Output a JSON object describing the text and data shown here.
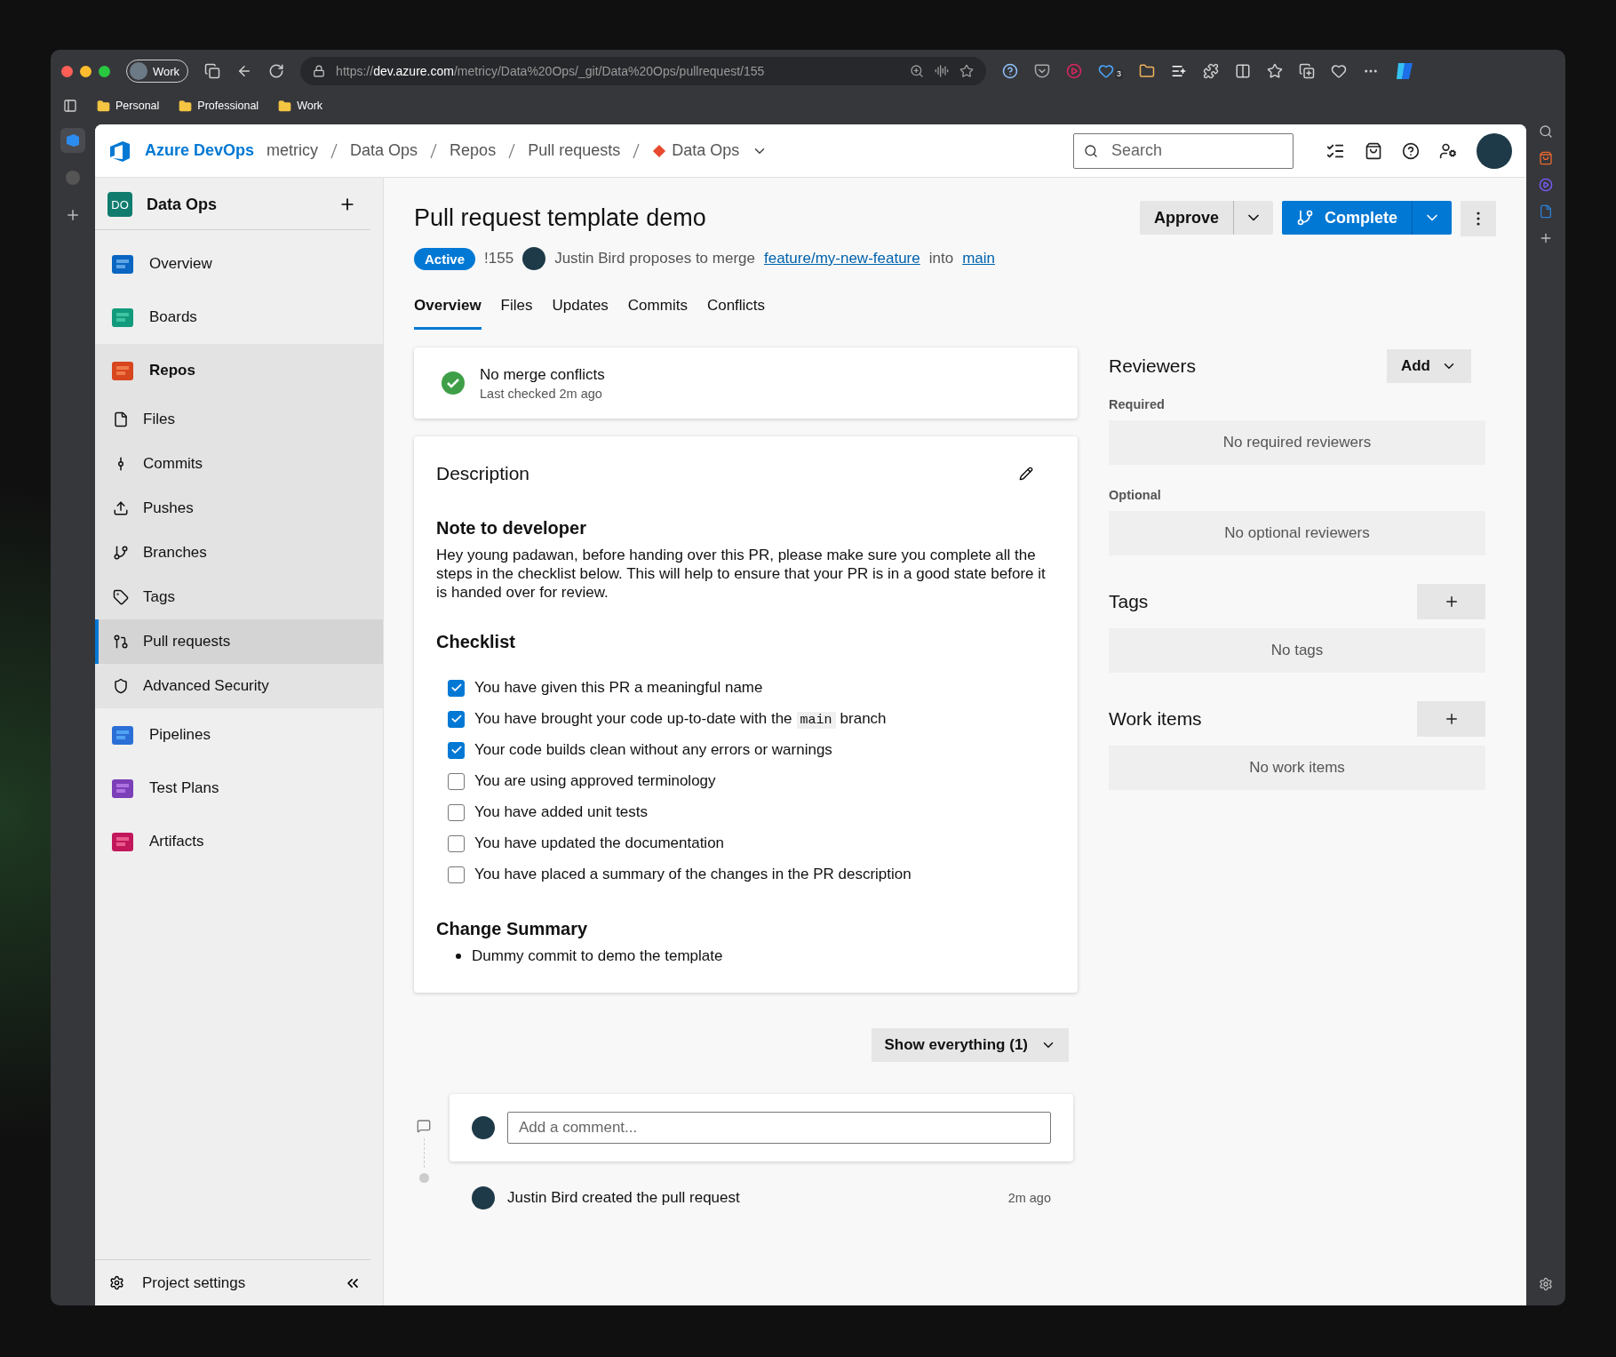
{
  "browser": {
    "profile": "Work",
    "url": {
      "scheme": "https://",
      "host": "dev.azure.com",
      "path": "/metricy/Data%20Ops/_git/Data%20Ops/pullrequest/155"
    },
    "extension_badge": "3",
    "bookmarks": [
      "Personal",
      "Professional",
      "Work"
    ]
  },
  "header": {
    "brand": "Azure DevOps",
    "breadcrumbs": [
      "metricy",
      "Data Ops",
      "Repos",
      "Pull requests",
      "Data Ops"
    ],
    "search": {
      "placeholder": "Search"
    }
  },
  "sidebar": {
    "project": {
      "initials": "DO",
      "name": "Data Ops"
    },
    "items": [
      {
        "label": "Overview",
        "selected": false
      },
      {
        "label": "Boards",
        "selected": false
      },
      {
        "label": "Repos",
        "selected": false,
        "expanded": true,
        "children": [
          {
            "label": "Files",
            "selected": false
          },
          {
            "label": "Commits",
            "selected": false
          },
          {
            "label": "Pushes",
            "selected": false
          },
          {
            "label": "Branches",
            "selected": false
          },
          {
            "label": "Tags",
            "selected": false
          },
          {
            "label": "Pull requests",
            "selected": true
          },
          {
            "label": "Advanced Security",
            "selected": false
          }
        ]
      },
      {
        "label": "Pipelines",
        "selected": false
      },
      {
        "label": "Test Plans",
        "selected": false
      },
      {
        "label": "Artifacts",
        "selected": false
      }
    ],
    "footer": "Project settings"
  },
  "pr": {
    "title": "Pull request template demo",
    "status": "Active",
    "id": "!155",
    "author": "Justin Bird",
    "merge_text": "proposes to merge",
    "source_branch": "feature/my-new-feature",
    "into_text": "into",
    "target_branch": "main",
    "approve": "Approve",
    "complete": "Complete",
    "tabs": [
      {
        "label": "Overview",
        "selected": true
      },
      {
        "label": "Files",
        "selected": false
      },
      {
        "label": "Updates",
        "selected": false
      },
      {
        "label": "Commits",
        "selected": false
      },
      {
        "label": "Conflicts",
        "selected": false
      }
    ]
  },
  "merge_status": {
    "title": "No merge conflicts",
    "subtitle": "Last checked 2m ago"
  },
  "description": {
    "heading": "Description",
    "note_heading": "Note to developer",
    "note": "Hey young padawan, before handing over this PR, please make sure you complete all the steps in the checklist below. This will help to ensure that your PR is in a good state before it is handed over for review.",
    "checklist_heading": "Checklist",
    "checklist": [
      {
        "checked": true,
        "parts": [
          {
            "kind": "text",
            "text": "You have given this PR a meaningful name"
          }
        ]
      },
      {
        "checked": true,
        "parts": [
          {
            "kind": "text",
            "text": "You have brought your code up-to-date with the"
          },
          {
            "kind": "code",
            "text": "main"
          },
          {
            "kind": "text",
            "text": "branch"
          }
        ]
      },
      {
        "checked": true,
        "parts": [
          {
            "kind": "text",
            "text": "Your code builds clean without any errors or warnings"
          }
        ]
      },
      {
        "checked": false,
        "parts": [
          {
            "kind": "text",
            "text": "You are using approved terminology"
          }
        ]
      },
      {
        "checked": false,
        "parts": [
          {
            "kind": "text",
            "text": "You have added unit tests"
          }
        ]
      },
      {
        "checked": false,
        "parts": [
          {
            "kind": "text",
            "text": "You have updated the documentation"
          }
        ]
      },
      {
        "checked": false,
        "parts": [
          {
            "kind": "text",
            "text": "You have placed a summary of the changes in the PR description"
          }
        ]
      }
    ],
    "summary_heading": "Change Summary",
    "summary": [
      "Dummy commit to demo the template"
    ]
  },
  "activity": {
    "filter": "Show everything (1)",
    "comment": {
      "placeholder": "Add a comment..."
    },
    "events": [
      {
        "text": "Justin Bird created the pull request",
        "time": "2m ago"
      }
    ]
  },
  "side": {
    "reviewers": {
      "heading": "Reviewers",
      "add": "Add",
      "groups": [
        {
          "label": "Required",
          "empty": "No required reviewers"
        },
        {
          "label": "Optional",
          "empty": "No optional reviewers"
        }
      ]
    },
    "sections": [
      {
        "heading": "Tags",
        "empty": "No tags"
      },
      {
        "heading": "Work items",
        "empty": "No work items"
      }
    ]
  }
}
